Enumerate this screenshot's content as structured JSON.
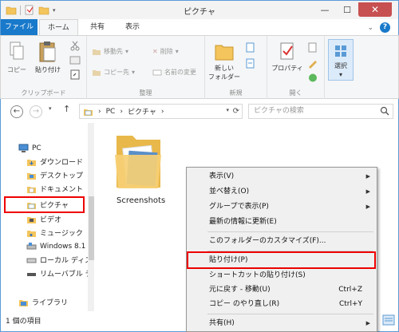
{
  "window": {
    "title": "ピクチャ"
  },
  "tabs": {
    "file": "ファイル",
    "home": "ホーム",
    "share": "共有",
    "view": "表示",
    "help": "?"
  },
  "ribbon": {
    "clipboard": {
      "copy": "コピー",
      "paste": "貼り付け",
      "label": "クリップボード"
    },
    "organize": {
      "move_to": "移動先",
      "copy_to": "コピー先",
      "delete": "削除",
      "rename": "名前の変更",
      "label": "整理"
    },
    "new": {
      "new_folder_line1": "新しい",
      "new_folder_line2": "フォルダー",
      "label": "新規"
    },
    "open": {
      "properties": "プロパティ",
      "label": "開く"
    },
    "select": {
      "select": "選択"
    }
  },
  "address": {
    "pc": "PC",
    "pictures": "ピクチャ",
    "search_placeholder": "ピクチャの検索"
  },
  "navpane": {
    "items": [
      {
        "label": "PC"
      },
      {
        "label": "ダウンロード"
      },
      {
        "label": "デスクトップ"
      },
      {
        "label": "ドキュメント"
      },
      {
        "label": "ピクチャ"
      },
      {
        "label": "ビデオ"
      },
      {
        "label": "ミュージック"
      },
      {
        "label": "Windows 8.1"
      },
      {
        "label": "ローカル ディスク"
      },
      {
        "label": "リムーバブル ディスク"
      },
      {
        "label": "ライブラリ"
      }
    ]
  },
  "content": {
    "folder_name": "Screenshots"
  },
  "status": {
    "item_count": "1 個の項目"
  },
  "context_menu": {
    "view": "表示(V)",
    "sort": "並べ替え(O)",
    "group": "グループで表示(P)",
    "refresh": "最新の情報に更新(E)",
    "customize": "このフォルダーのカスタマイズ(F)...",
    "paste": "貼り付け(P)",
    "paste_shortcut": "ショートカットの貼り付け(S)",
    "undo": "元に戻す - 移動(U)",
    "undo_shortcut": "Ctrl+Z",
    "redo": "コピー のやり直し(R)",
    "redo_shortcut": "Ctrl+Y",
    "share": "共有(H)"
  },
  "colors": {
    "accent": "#1979ca",
    "highlight": "#e00000",
    "folder": "#f4c55c"
  }
}
